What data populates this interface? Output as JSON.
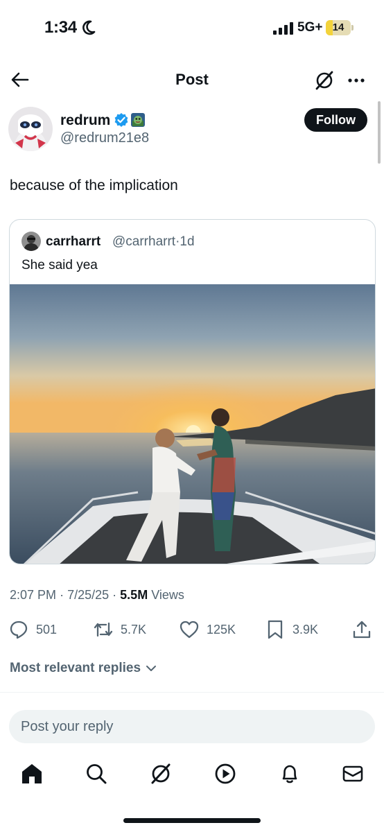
{
  "status_bar": {
    "time": "1:34",
    "network": "5G+",
    "battery": "14",
    "battery_level": 0.14
  },
  "header": {
    "title": "Post"
  },
  "author": {
    "name": "redrum",
    "handle": "@redrum21e8",
    "follow_label": "Follow"
  },
  "post": {
    "text": "because of the implication"
  },
  "quote": {
    "name": "carrharrt",
    "handle": "@carrharrt",
    "time": "1d",
    "text": "She said yea"
  },
  "meta": {
    "time": "2:07 PM",
    "date": "7/25/25",
    "views_count": "5.5M",
    "views_label": "Views",
    "sep": "·"
  },
  "actions": {
    "replies": "501",
    "reposts": "5.7K",
    "likes": "125K",
    "bookmarks": "3.9K"
  },
  "replies_filter": {
    "label": "Most relevant replies"
  },
  "reply_box": {
    "placeholder": "Post your reply"
  },
  "colors": {
    "text": "#0f1419",
    "secondary": "#536471",
    "accent": "#1d9bf0",
    "border": "#cfd9de"
  },
  "icons": [
    "back-arrow-icon",
    "grok-icon",
    "more-icon",
    "verified-icon",
    "reply-icon",
    "repost-icon",
    "like-icon",
    "bookmark-icon",
    "share-icon",
    "home-icon",
    "search-icon",
    "grok-icon",
    "video-icon",
    "bell-icon",
    "mail-icon"
  ]
}
